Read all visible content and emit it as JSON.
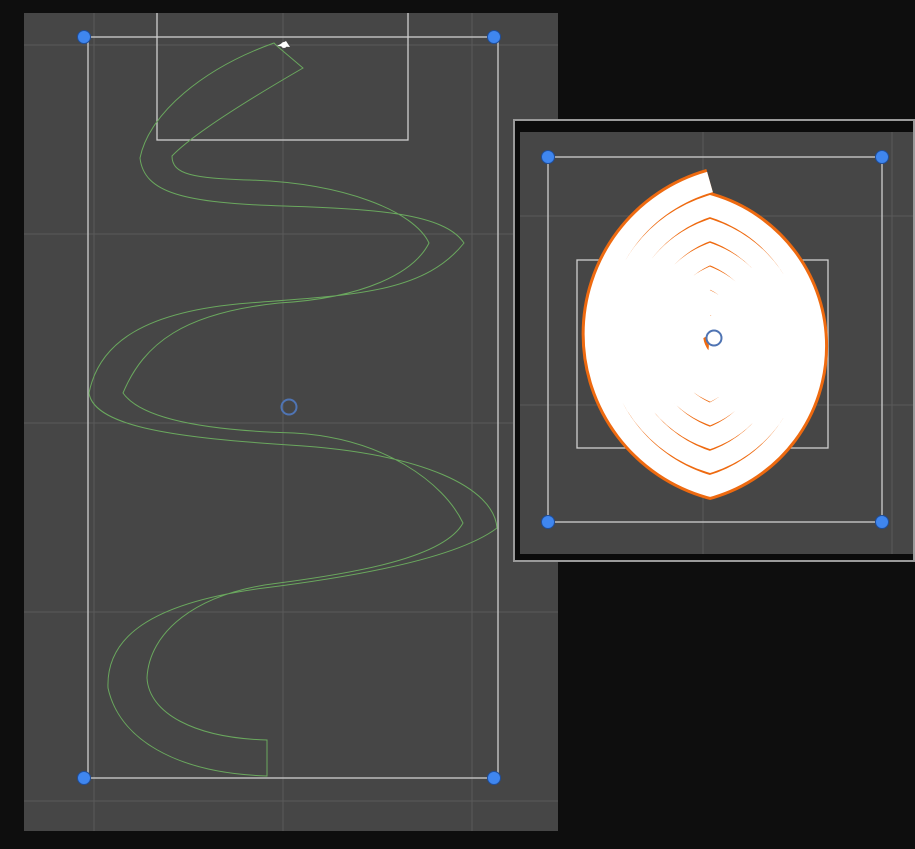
{
  "colors": {
    "background": "#0e0e0e",
    "scene_gray": "#464646",
    "grid": "#5a5a5a",
    "rect_outline": "#cfcfcf",
    "handle_blue": "#3f86ef",
    "pivot_blue": "#4f74b3",
    "green_outline": "#6aa85e",
    "spiral_fill": "#ffffff",
    "spiral_outline": "#ee6a10"
  },
  "icons": {
    "handle": "blue-circle-handle-icon",
    "pivot": "pivot-ring-icon",
    "vertex_cursor": "white-vertex-icon"
  }
}
